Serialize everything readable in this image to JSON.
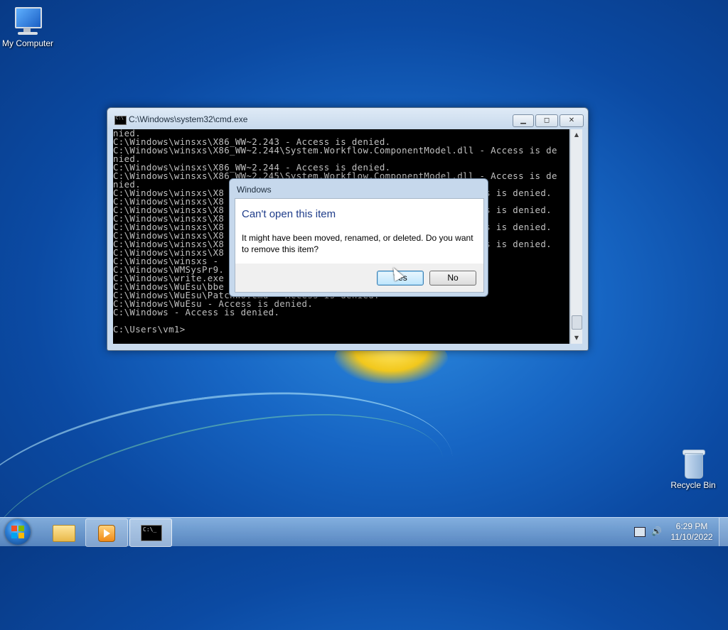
{
  "desktop": {
    "icons": [
      {
        "label": "My Computer",
        "icon": "computer-icon"
      },
      {
        "label": "Recycle Bin",
        "icon": "recycle-bin-icon"
      }
    ]
  },
  "cmd_window": {
    "title": "C:\\Windows\\system32\\cmd.exe",
    "controls": {
      "minimize": "minimize-icon",
      "maximize": "maximize-icon",
      "close": "close-icon"
    },
    "lines": [
      "nied.",
      "C:\\Windows\\winsxs\\X86_WW~2.243 - Access is denied.",
      "C:\\Windows\\winsxs\\X86_WW~2.244\\System.Workflow.ComponentModel.dll - Access is de",
      "nied.",
      "C:\\Windows\\winsxs\\X86_WW~2.244 - Access is denied.",
      "C:\\Windows\\winsxs\\X86_WW~2.245\\System.Workflow.ComponentModel.dll - Access is de",
      "nied.",
      "C:\\Windows\\winsxs\\X8                                               s is denied.",
      "C:\\Windows\\winsxs\\X8",
      "C:\\Windows\\winsxs\\X8                                               s is denied.",
      "C:\\Windows\\winsxs\\X8",
      "C:\\Windows\\winsxs\\X8                                               s is denied.",
      "C:\\Windows\\winsxs\\X8",
      "C:\\Windows\\winsxs\\X8                                               s is denied.",
      "C:\\Windows\\winsxs\\X8",
      "C:\\Windows\\winsxs - ",
      "C:\\Windows\\WMSysPr9.",
      "C:\\Windows\\write.exe",
      "C:\\Windows\\WuEsu\\bbe",
      "C:\\Windows\\WuEsu\\PatchWU.cmd - Access is denied.",
      "C:\\Windows\\WuEsu - Access is denied.",
      "C:\\Windows - Access is denied.",
      "",
      "C:\\Users\\vm1>"
    ]
  },
  "dialog": {
    "title": "Windows",
    "heading": "Can't open this item",
    "message": "It might have been moved, renamed, or deleted. Do you want to remove this item?",
    "yes_label": "Yes",
    "no_label": "No"
  },
  "taskbar": {
    "start": "start-orb-icon",
    "pinned": [
      {
        "name": "windows-explorer",
        "icon": "folder-icon"
      },
      {
        "name": "windows-media-player",
        "icon": "media-player-icon"
      },
      {
        "name": "command-prompt",
        "icon": "cmd-icon"
      }
    ],
    "tray": {
      "network": "network-icon",
      "volume": "volume-icon"
    },
    "clock": {
      "time": "6:29 PM",
      "date": "11/10/2022"
    }
  }
}
